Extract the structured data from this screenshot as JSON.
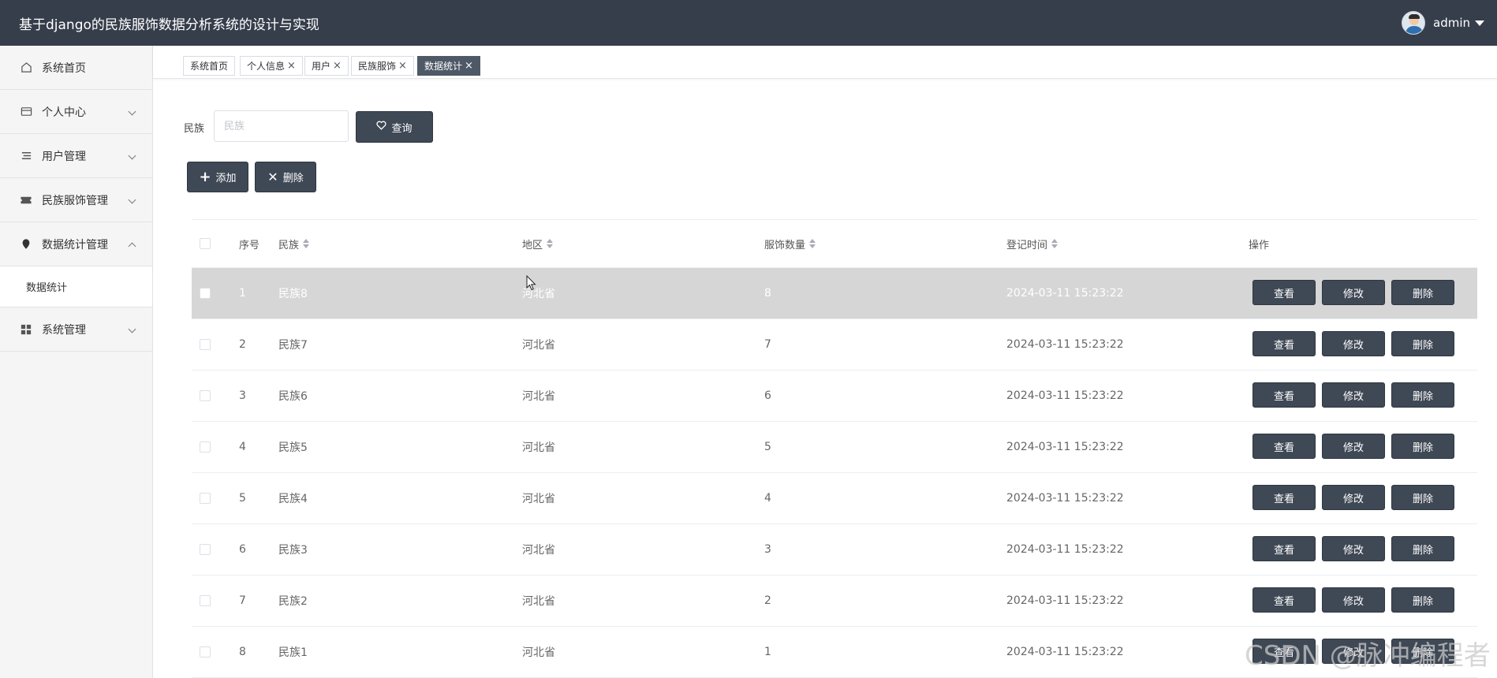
{
  "app": {
    "title": "基于django的民族服饰数据分析系统的设计与实现",
    "user": "admin"
  },
  "sidebar": {
    "items": [
      {
        "label": "系统首页",
        "icon": "home-icon"
      },
      {
        "label": "个人中心",
        "icon": "card-icon"
      },
      {
        "label": "用户管理",
        "icon": "list-icon"
      },
      {
        "label": "民族服饰管理",
        "icon": "ticket-icon"
      },
      {
        "label": "数据统计管理",
        "icon": "pin-icon",
        "expanded": true
      },
      {
        "label": "系统管理",
        "icon": "grid-icon"
      }
    ],
    "submenu": {
      "label": "数据统计"
    }
  },
  "tabs": [
    {
      "label": "系统首页",
      "closable": false
    },
    {
      "label": "个人信息",
      "closable": true
    },
    {
      "label": "用户",
      "closable": true
    },
    {
      "label": "民族服饰",
      "closable": true
    },
    {
      "label": "数据统计",
      "closable": true,
      "active": true
    }
  ],
  "tab_close": "×",
  "search": {
    "label": "民族",
    "placeholder": "民族",
    "value": "",
    "button": "查询"
  },
  "toolbar": {
    "add": "添加",
    "delete": "删除"
  },
  "table": {
    "columns": [
      "序号",
      "民族",
      "地区",
      "服饰数量",
      "登记时间",
      "操作"
    ],
    "rows": [
      {
        "index": "1",
        "nation": "民族8",
        "region": "河北省",
        "count": "8",
        "time": "2024-03-11 15:23:22"
      },
      {
        "index": "2",
        "nation": "民族7",
        "region": "河北省",
        "count": "7",
        "time": "2024-03-11 15:23:22"
      },
      {
        "index": "3",
        "nation": "民族6",
        "region": "河北省",
        "count": "6",
        "time": "2024-03-11 15:23:22"
      },
      {
        "index": "4",
        "nation": "民族5",
        "region": "河北省",
        "count": "5",
        "time": "2024-03-11 15:23:22"
      },
      {
        "index": "5",
        "nation": "民族4",
        "region": "河北省",
        "count": "4",
        "time": "2024-03-11 15:23:22"
      },
      {
        "index": "6",
        "nation": "民族3",
        "region": "河北省",
        "count": "3",
        "time": "2024-03-11 15:23:22"
      },
      {
        "index": "7",
        "nation": "民族2",
        "region": "河北省",
        "count": "2",
        "time": "2024-03-11 15:23:22"
      },
      {
        "index": "8",
        "nation": "民族1",
        "region": "河北省",
        "count": "1",
        "time": "2024-03-11 15:23:22"
      }
    ],
    "actions": {
      "view": "查看",
      "edit": "修改",
      "delete": "删除"
    }
  },
  "watermark": "CSDN @脉冲编程者",
  "colors": {
    "header_bg": "#363e4b",
    "button_bg": "#3f4855",
    "hover_row": "#d6d6d6"
  }
}
